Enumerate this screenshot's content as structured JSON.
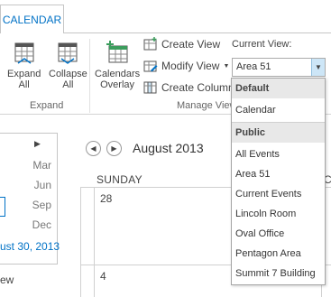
{
  "ribbon": {
    "tab_label": "CALENDAR",
    "expand_all": "Expand All",
    "collapse_all": "Collapse All",
    "expand_group_label": "Expand",
    "calendars_overlay": "Calendars Overlay",
    "create_view": "Create View",
    "modify_view": "Modify View",
    "create_column": "Create Column",
    "manage_group_label": "Manage View",
    "current_view_label": "Current View:",
    "current_view_value": "Area 51"
  },
  "dropdown": {
    "default_header": "Default",
    "default_items": [
      "Calendar"
    ],
    "public_header": "Public",
    "public_items": [
      "All Events",
      "Area 51",
      "Current Events",
      "Lincoln Room",
      "Oval Office",
      "Pentagon Area",
      "Summit 7 Building"
    ]
  },
  "picker": {
    "months": [
      "Mar",
      "Jun",
      "Sep",
      "Dec"
    ],
    "date_link": "ust 30, 2013",
    "view_label": "ew"
  },
  "calendar": {
    "month_title": "August 2013",
    "col_sunday": "SUNDAY",
    "col_next": "C",
    "day_1": "28",
    "day_2": "4"
  },
  "colors": {
    "accent": "#0072c6",
    "border": "#c6c6c6"
  }
}
